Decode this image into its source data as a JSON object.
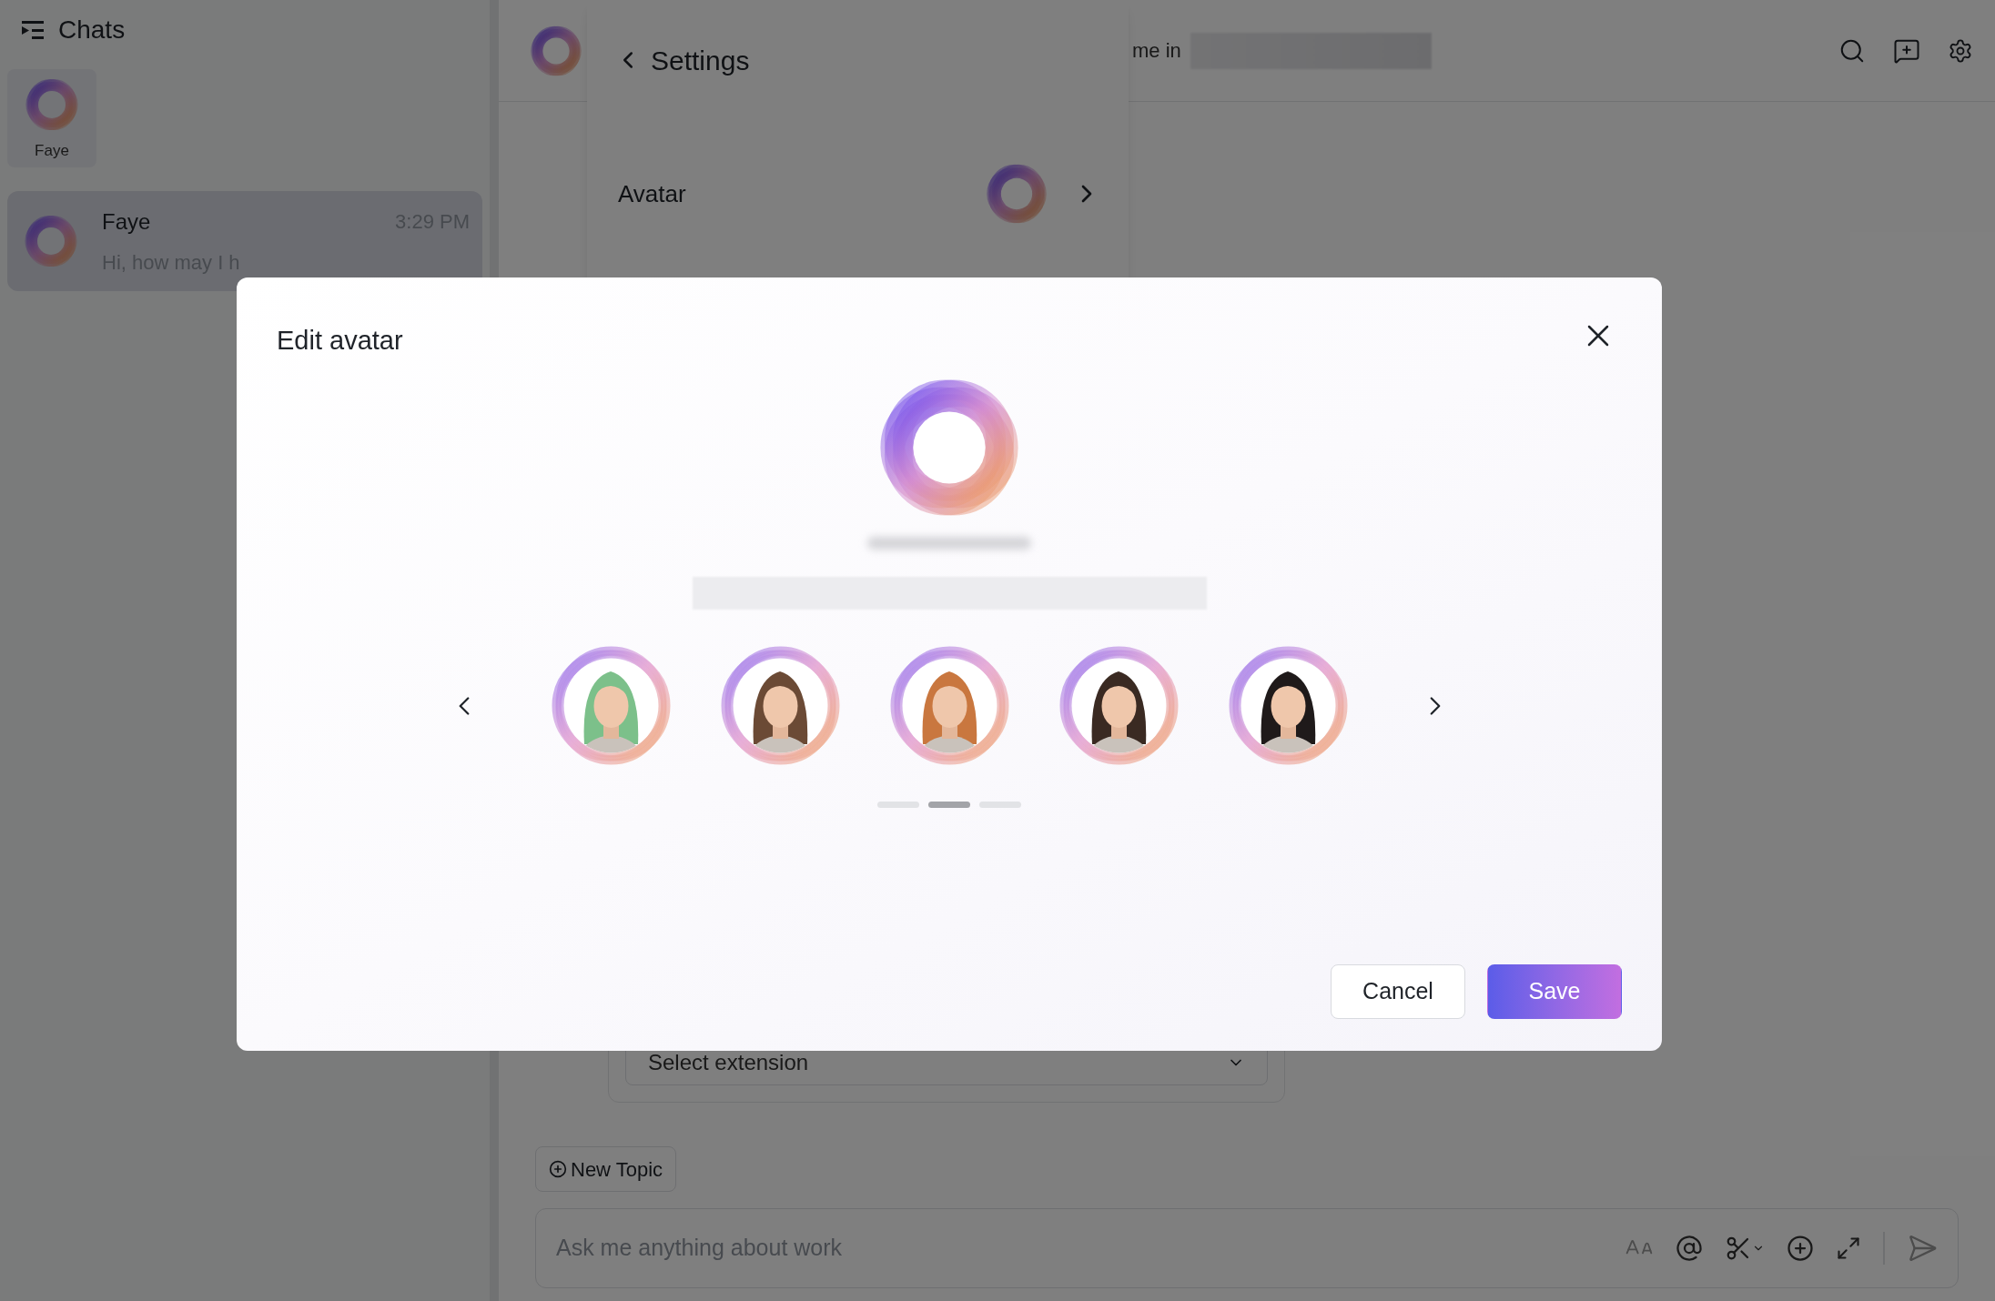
{
  "sidebar": {
    "title": "Chats",
    "pinned": [
      {
        "name": "Faye"
      }
    ],
    "chats": [
      {
        "name": "Faye",
        "time": "3:29 PM",
        "preview": "Hi, how may I h",
        "selected": true
      }
    ]
  },
  "header": {
    "title_fragment": "me in"
  },
  "settings_panel": {
    "title": "Settings",
    "rows": [
      {
        "label": "Avatar"
      }
    ]
  },
  "extension_select": {
    "placeholder": "Select extension"
  },
  "new_topic": "New Topic",
  "composer": {
    "placeholder": "Ask me anything about work"
  },
  "dialog": {
    "title": "Edit avatar",
    "avatars": [
      {
        "color": "#7cc08a"
      },
      {
        "color": "#6b4a35"
      },
      {
        "color": "#c9773f"
      },
      {
        "color": "#3a2a22"
      },
      {
        "color": "#1f1a1a"
      }
    ],
    "pages": [
      {
        "selected": false
      },
      {
        "selected": true
      },
      {
        "selected": false
      }
    ],
    "buttons": [
      {
        "label": "Cancel",
        "kind": "secondary"
      },
      {
        "label": "Save",
        "kind": "primary"
      }
    ]
  }
}
